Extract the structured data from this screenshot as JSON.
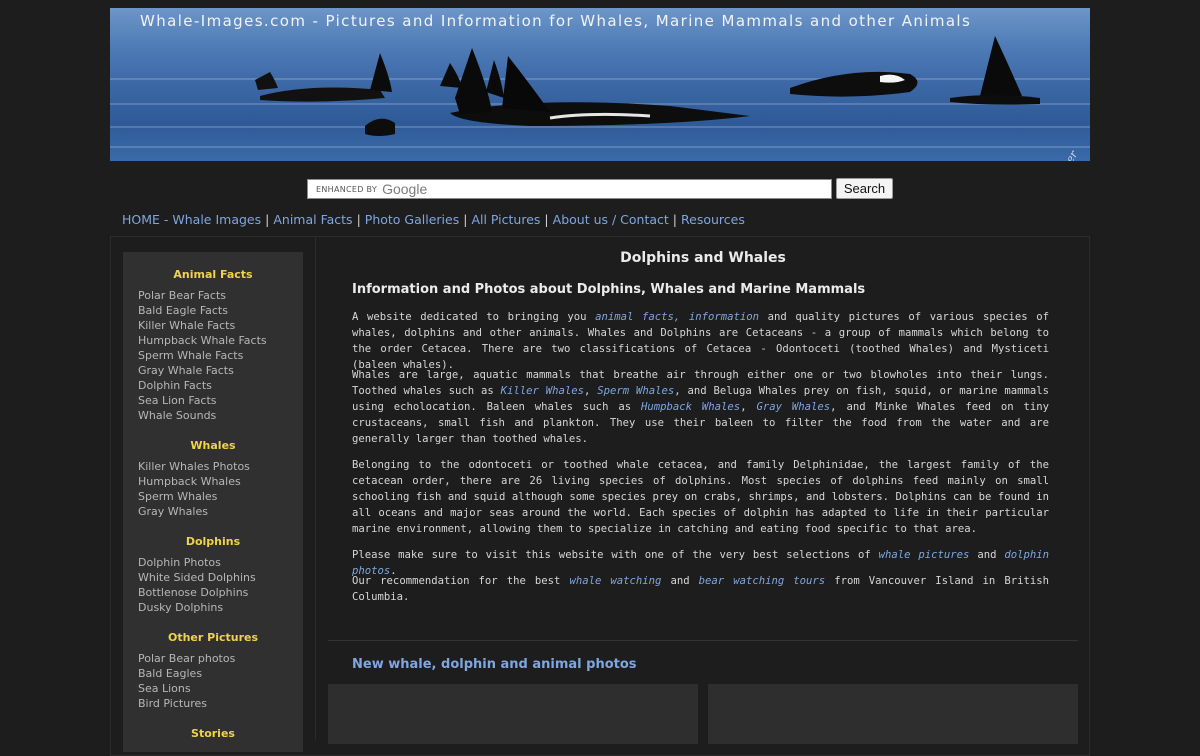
{
  "banner": {
    "title": "Whale-Images.com - Pictures and Information for Whales, Marine Mammals and other Animals",
    "signature": "Ralf Kiefner",
    "image_label": "orca-pod-photo"
  },
  "search": {
    "enhanced_by": "ENHANCED BY",
    "google": "Google",
    "button": "Search"
  },
  "nav": {
    "items": [
      "HOME - Whale Images",
      "Animal Facts",
      "Photo Galleries",
      "All Pictures",
      "About us / Contact",
      "Resources"
    ],
    "separator": "|"
  },
  "sidebar": {
    "groups": [
      {
        "title": "Animal Facts",
        "links": [
          "Polar Bear Facts",
          "Bald Eagle Facts",
          "Killer Whale Facts",
          "Humpback Whale Facts",
          "Sperm Whale Facts",
          "Gray Whale Facts",
          "Dolphin Facts",
          "Sea Lion Facts",
          "Whale Sounds"
        ]
      },
      {
        "title": "Whales",
        "links": [
          "Killer Whales Photos",
          "Humpback Whales",
          "Sperm Whales",
          "Gray Whales"
        ]
      },
      {
        "title": "Dolphins",
        "links": [
          "Dolphin Photos",
          "White Sided Dolphins",
          "Bottlenose Dolphins",
          "Dusky Dolphins"
        ]
      },
      {
        "title": "Other Pictures",
        "links": [
          "Polar Bear photos",
          "Bald Eagles",
          "Sea Lions",
          "Bird Pictures"
        ]
      },
      {
        "title": "Stories",
        "links": []
      }
    ]
  },
  "main": {
    "title": "Dolphins and Whales",
    "subtitle": "Information and Photos about Dolphins, Whales and Marine Mammals",
    "p1": {
      "t1": "A website dedicated to bringing you ",
      "link1": "animal facts, information",
      "t2": " and quality pictures of various species of whales, dolphins and other animals. Whales and Dolphins are Cetaceans - a group of mammals which belong to the order Cetacea. There are two classifications of Cetacea - Odontoceti (toothed Whales) and Mysticeti (baleen whales)."
    },
    "p2": {
      "t1": "Whales are large, aquatic mammals that breathe air through either one or two blowholes into their lungs. Toothed whales such as ",
      "link1": "Killer Whales",
      "t2": ", ",
      "link2": "Sperm Whales",
      "t3": ", and Beluga Whales prey on fish, squid, or marine mammals using echolocation. Baleen whales such as ",
      "link3": "Humpback Whales",
      "t4": ", ",
      "link4": "Gray Whales",
      "t5": ", and Minke Whales feed on tiny crustaceans, small fish and plankton. They use their baleen to filter the food from the water and are generally larger than toothed whales."
    },
    "p3": "Belonging to the odontoceti or toothed whale cetacea, and family Delphinidae, the largest family of the cetacean order, there are 26 living species of dolphins. Most species of dolphins feed mainly on small schooling fish and squid although some species prey on crabs, shrimps, and lobsters. Dolphins can be found in all oceans and major seas around the world. Each species of dolphin has adapted to life in their particular marine environment, allowing them to specialize in catching and eating food specific to that area.",
    "p4": {
      "t1": "Please make sure to visit this website with one of the very best selections of ",
      "link1": "whale pictures",
      "t2": " and ",
      "link2": "dolphin photos",
      "t3": "."
    },
    "p5": {
      "t1": "Our recommendation for the best ",
      "link1": "whale watching",
      "t2": " and ",
      "link2": "bear watching tours",
      "t3": " from Vancouver Island in British Columbia."
    },
    "new_photos_heading": "New whale, dolphin and animal photos"
  },
  "colors": {
    "link": "#7fa6e0",
    "sidebar_heading": "#f0d34a",
    "background": "#1d1d1d",
    "sidebar_bg": "#303030"
  }
}
